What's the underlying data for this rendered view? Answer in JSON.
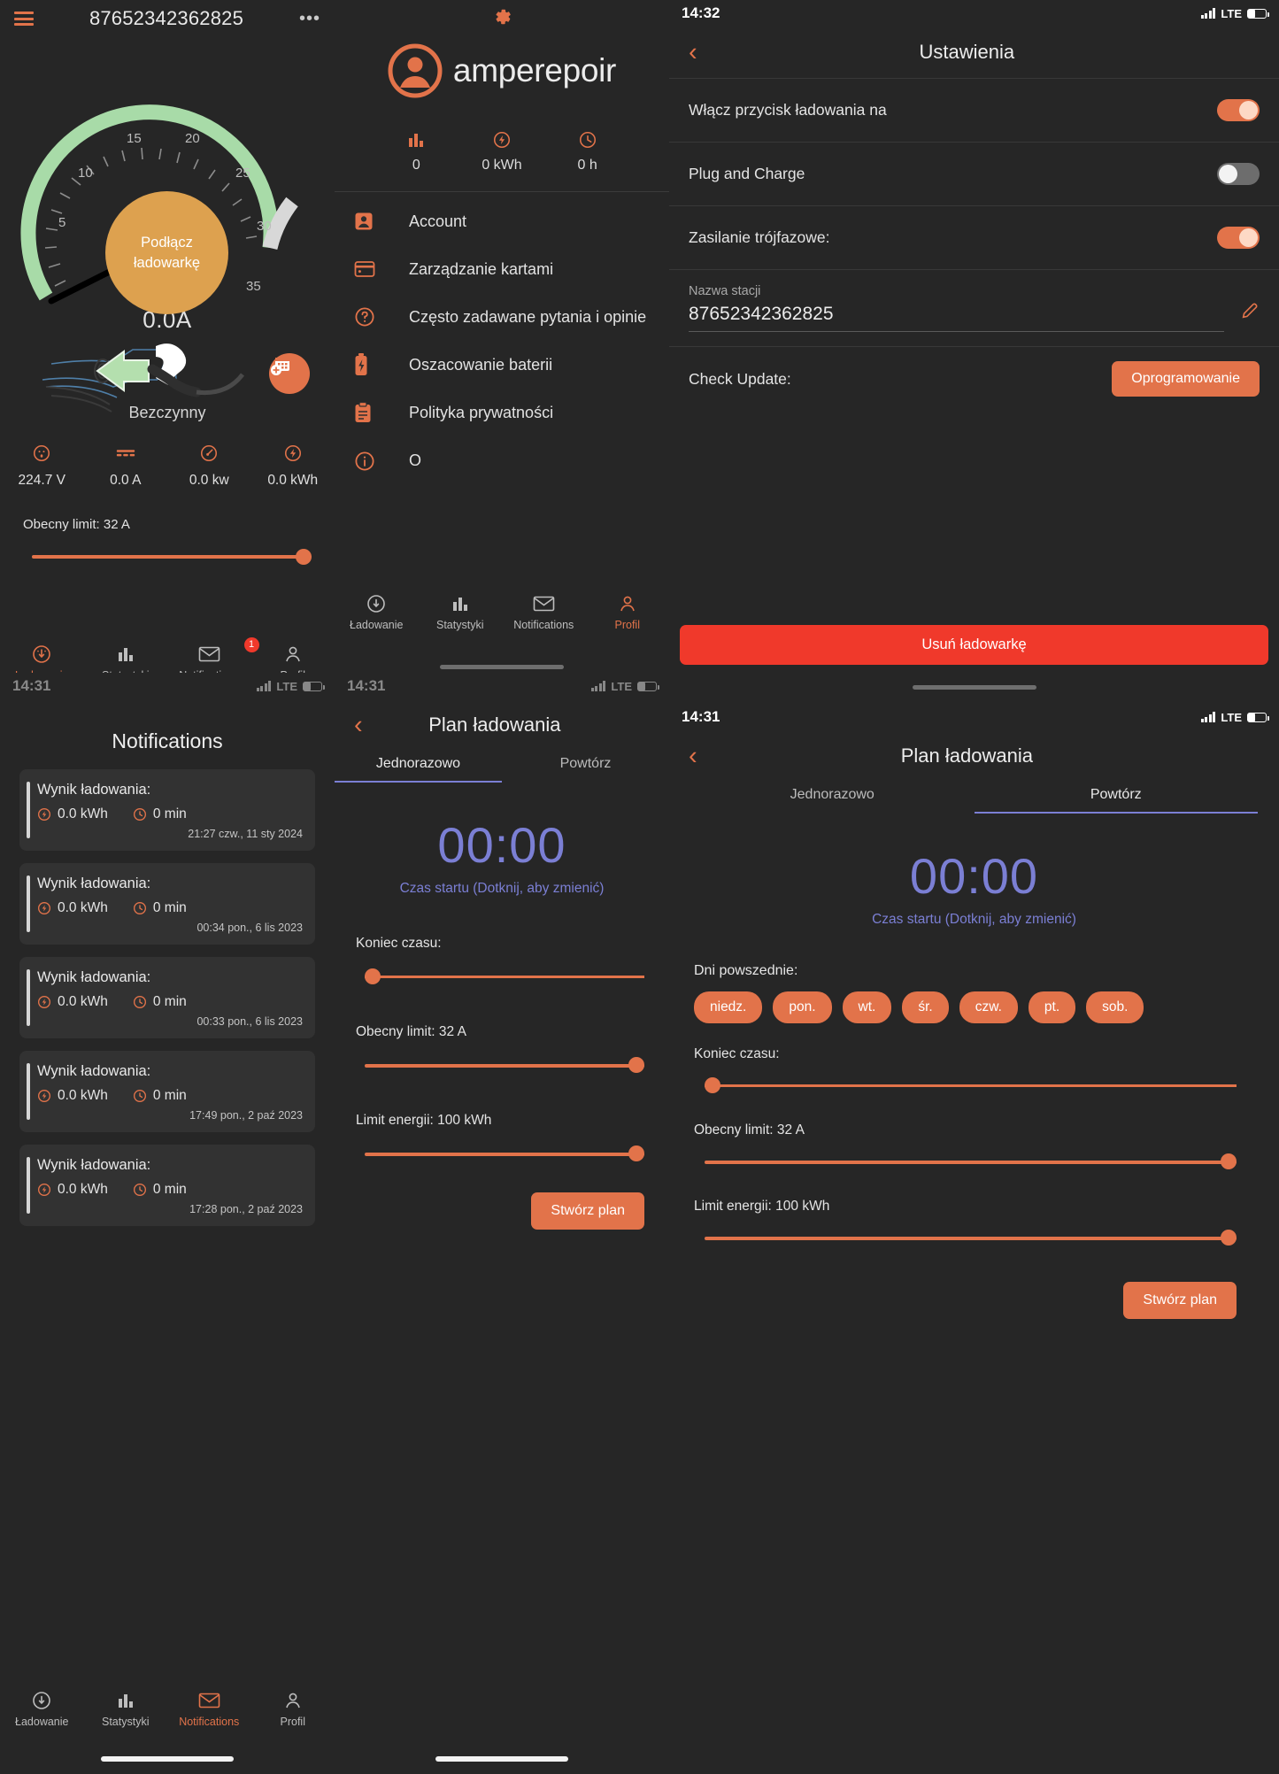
{
  "colors": {
    "accent": "#e2734a",
    "danger": "#f0392b",
    "gauge_green": "#a8dba8",
    "gauge_grey": "#d8d8d8",
    "gauge_knob": "#dda14f",
    "period_purple": "#7b7fd4",
    "bg": "#262626",
    "card": "#323232"
  },
  "charging_screen": {
    "title": "87652342362825",
    "menu_icon": "hamburger-icon",
    "more_icon": "more-options-icon",
    "gauge": {
      "center_label": "Podłącz\nładowarkę",
      "center_line1": "Podłącz",
      "center_line2": "ładowarkę",
      "ticks": [
        "5",
        "10",
        "15",
        "20",
        "25",
        "30",
        "35"
      ],
      "min": 0,
      "max": 40,
      "needle_value": 0,
      "green_end": 32
    },
    "current_reading": "0.0A",
    "status": "Bezczynny",
    "fab_icon": "add-schedule-icon",
    "metrics": [
      {
        "icon": "outlet-icon",
        "value": "224.7 V"
      },
      {
        "icon": "current-icon",
        "value": "0.0 A"
      },
      {
        "icon": "power-gauge-icon",
        "value": "0.0 kw"
      },
      {
        "icon": "energy-bolt-icon",
        "value": "0.0 kWh"
      }
    ],
    "limit_label": "Obecny limit: 32 A",
    "limit_value": 32,
    "limit_max": 32
  },
  "tabbar": {
    "items": [
      {
        "label": "Ładowanie",
        "icon": "charging-gauge-icon"
      },
      {
        "label": "Statystyki",
        "icon": "bar-chart-icon"
      },
      {
        "label": "Notifications",
        "icon": "envelope-icon",
        "badge": "1"
      },
      {
        "label": "Profil",
        "icon": "person-icon"
      }
    ]
  },
  "profile_screen": {
    "gear_icon": "gear-icon",
    "avatar_icon": "avatar-icon",
    "brand_name": "amperepoir",
    "metrics": [
      {
        "icon": "bar-chart-icon",
        "value": "0"
      },
      {
        "icon": "energy-bolt-icon",
        "value": "0 kWh"
      },
      {
        "icon": "clock-icon",
        "value": "0 h"
      }
    ],
    "menu": [
      {
        "icon": "account-icon",
        "label": "Account"
      },
      {
        "icon": "card-icon",
        "label": "Zarządzanie kartami"
      },
      {
        "icon": "question-icon",
        "label": "Często zadawane pytania i opinie"
      },
      {
        "icon": "battery-icon",
        "label": "Oszacowanie baterii"
      },
      {
        "icon": "clipboard-icon",
        "label": "Polityka prywatności"
      },
      {
        "icon": "info-icon",
        "label": "O"
      }
    ]
  },
  "settings_screen": {
    "status_time": "14:32",
    "status_network": "LTE",
    "back_icon": "chevron-left-icon",
    "title": "Ustawienia",
    "rows": [
      {
        "label": "Włącz przycisk ładowania na",
        "toggle": "on"
      },
      {
        "label": "Plug and Charge",
        "toggle": "off"
      },
      {
        "label": "Zasilanie trójfazowe:",
        "toggle": "on"
      }
    ],
    "station_field": {
      "label": "Nazwa stacji",
      "value": "87652342362825",
      "edit_icon": "pencil-icon"
    },
    "update": {
      "label": "Check Update:",
      "button": "Oprogramowanie"
    },
    "delete_button": "Usuń ładowarkę"
  },
  "notifications_screen": {
    "status_time": "14:31",
    "status_network": "LTE",
    "title": "Notifications",
    "cards": [
      {
        "heading": "Wynik ładowania:",
        "energy": "0.0 kWh",
        "duration": "0 min",
        "timestamp": "21:27 czw., 11 sty 2024"
      },
      {
        "heading": "Wynik ładowania:",
        "energy": "0.0 kWh",
        "duration": "0 min",
        "timestamp": "00:34 pon., 6 lis 2023"
      },
      {
        "heading": "Wynik ładowania:",
        "energy": "0.0 kWh",
        "duration": "0 min",
        "timestamp": "00:33 pon., 6 lis 2023"
      },
      {
        "heading": "Wynik ładowania:",
        "energy": "0.0 kWh",
        "duration": "0 min",
        "timestamp": "17:49 pon., 2 paź 2023"
      },
      {
        "heading": "Wynik ładowania:",
        "energy": "0.0 kWh",
        "duration": "0 min",
        "timestamp": "17:28 pon., 2 paź 2023"
      }
    ]
  },
  "plan_once_screen": {
    "status_time": "14:31",
    "status_network": "LTE",
    "back_icon": "chevron-left-icon",
    "title": "Plan ładowania",
    "tabs": [
      {
        "label": "Jednorazowo",
        "selected": true
      },
      {
        "label": "Powtórz",
        "selected": false
      }
    ],
    "start_time": "00:00",
    "start_hint": "Czas startu (Dotknij, aby zmienić)",
    "end_label": "Koniec czasu:",
    "end_value": 0,
    "current_limit_label": "Obecny limit: 32 A",
    "current_limit_value": 32,
    "energy_limit_label": "Limit energii: 100 kWh",
    "energy_limit_value": 100,
    "create_button": "Stwórz plan"
  },
  "plan_repeat_screen": {
    "status_time": "14:31",
    "status_network": "LTE",
    "back_icon": "chevron-left-icon",
    "title": "Plan ładowania",
    "tabs": [
      {
        "label": "Jednorazowo",
        "selected": false
      },
      {
        "label": "Powtórz",
        "selected": true
      }
    ],
    "start_time": "00:00",
    "start_hint": "Czas startu (Dotknij, aby zmienić)",
    "weekdays_label": "Dni powszednie:",
    "weekdays": [
      "niedz.",
      "pon.",
      "wt.",
      "śr.",
      "czw.",
      "pt.",
      "sob."
    ],
    "end_label": "Koniec czasu:",
    "end_value": 0,
    "current_limit_label": "Obecny limit: 32 A",
    "current_limit_value": 32,
    "energy_limit_label": "Limit energii: 100 kWh",
    "energy_limit_value": 100,
    "create_button": "Stwórz plan"
  }
}
